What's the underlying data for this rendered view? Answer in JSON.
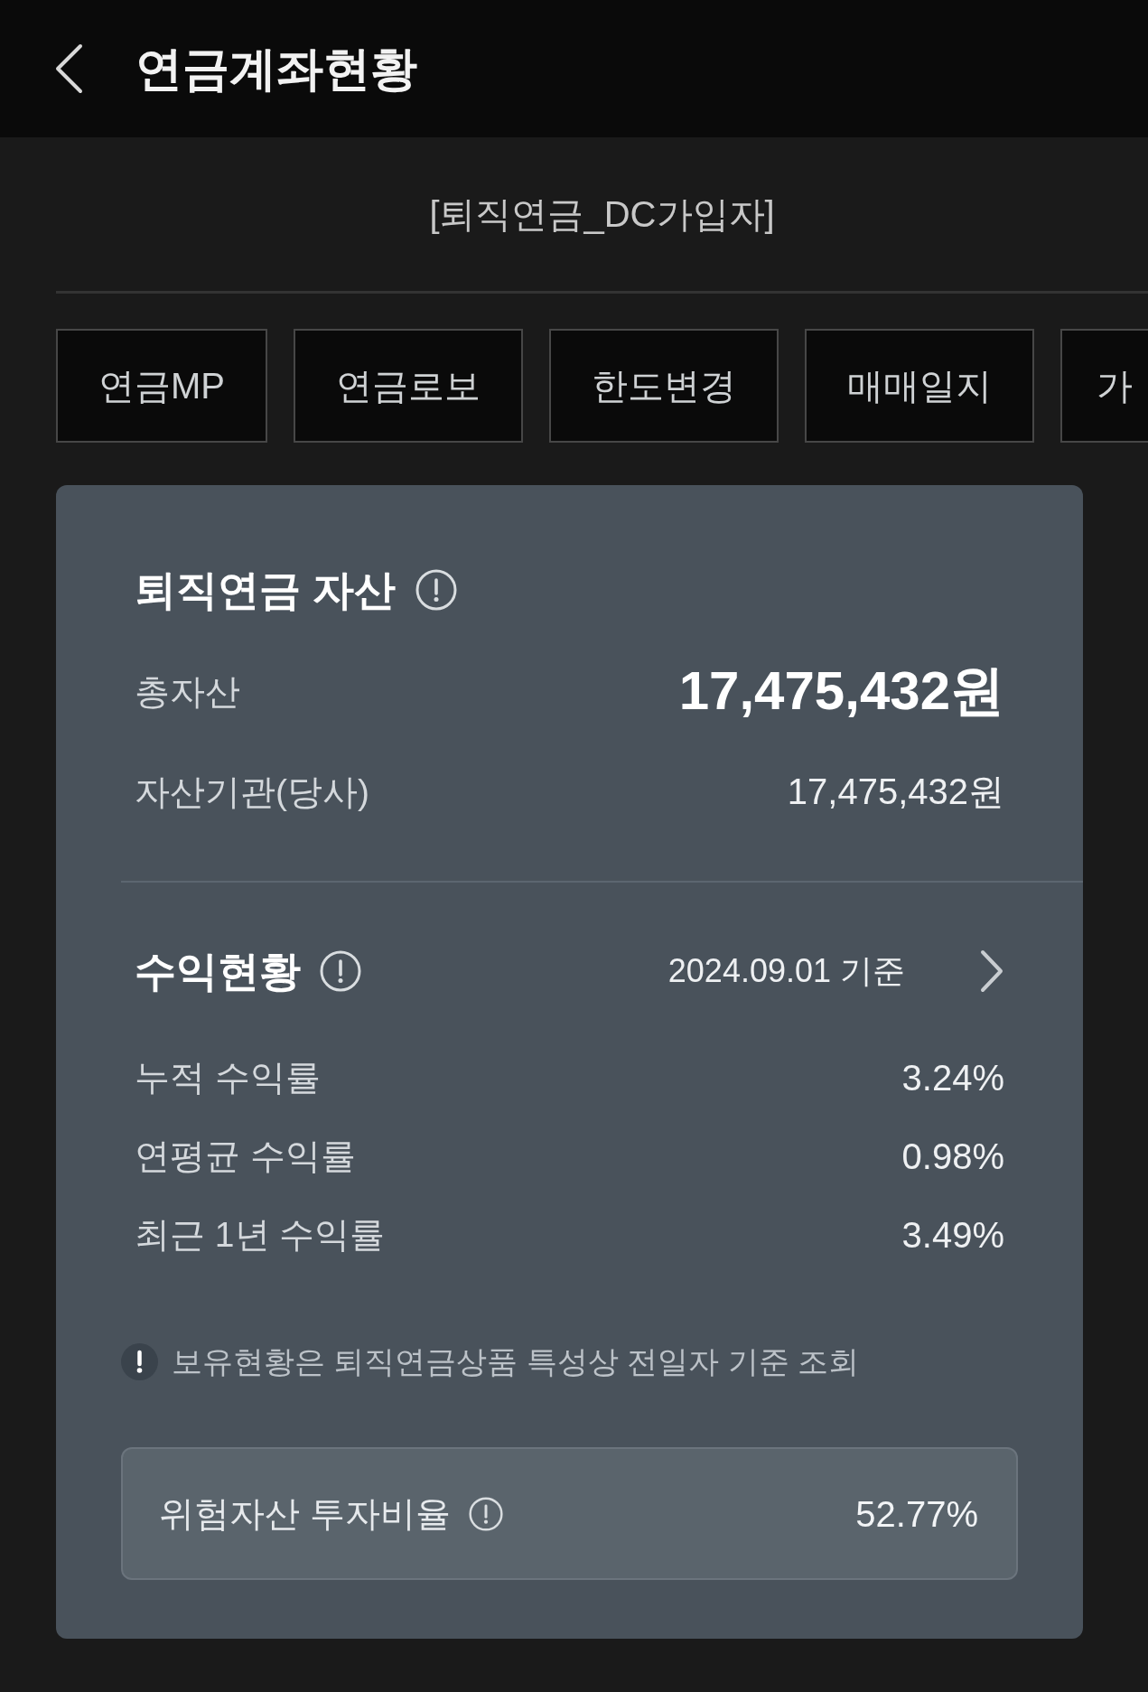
{
  "header": {
    "title": "연금계좌현황"
  },
  "plan_label": "[퇴직연금_DC가입자]",
  "menu_buttons": [
    {
      "label": "연금MP"
    },
    {
      "label": "연금로보"
    },
    {
      "label": "한도변경"
    },
    {
      "label": "매매일지"
    },
    {
      "label": "가"
    }
  ],
  "assets": {
    "title": "퇴직연금 자산",
    "rows": [
      {
        "kind": "total",
        "label": "총자산",
        "value": "17,475,432원"
      },
      {
        "kind": "detail",
        "label": "자산기관(당사)",
        "value": "17,475,432원"
      }
    ]
  },
  "returns": {
    "title": "수익현황",
    "as_of": "2024.09.01 기준",
    "rows": [
      {
        "label": "누적 수익률",
        "value": "3.24%"
      },
      {
        "label": "연평균 수익률",
        "value": "0.98%"
      },
      {
        "label": "최근 1년 수익률",
        "value": "3.49%"
      }
    ]
  },
  "notice": "보유현황은 퇴직연금상품 특성상 전일자 기준 조회",
  "risk_ratio": {
    "label": "위험자산 투자비율",
    "value": "52.77%"
  }
}
